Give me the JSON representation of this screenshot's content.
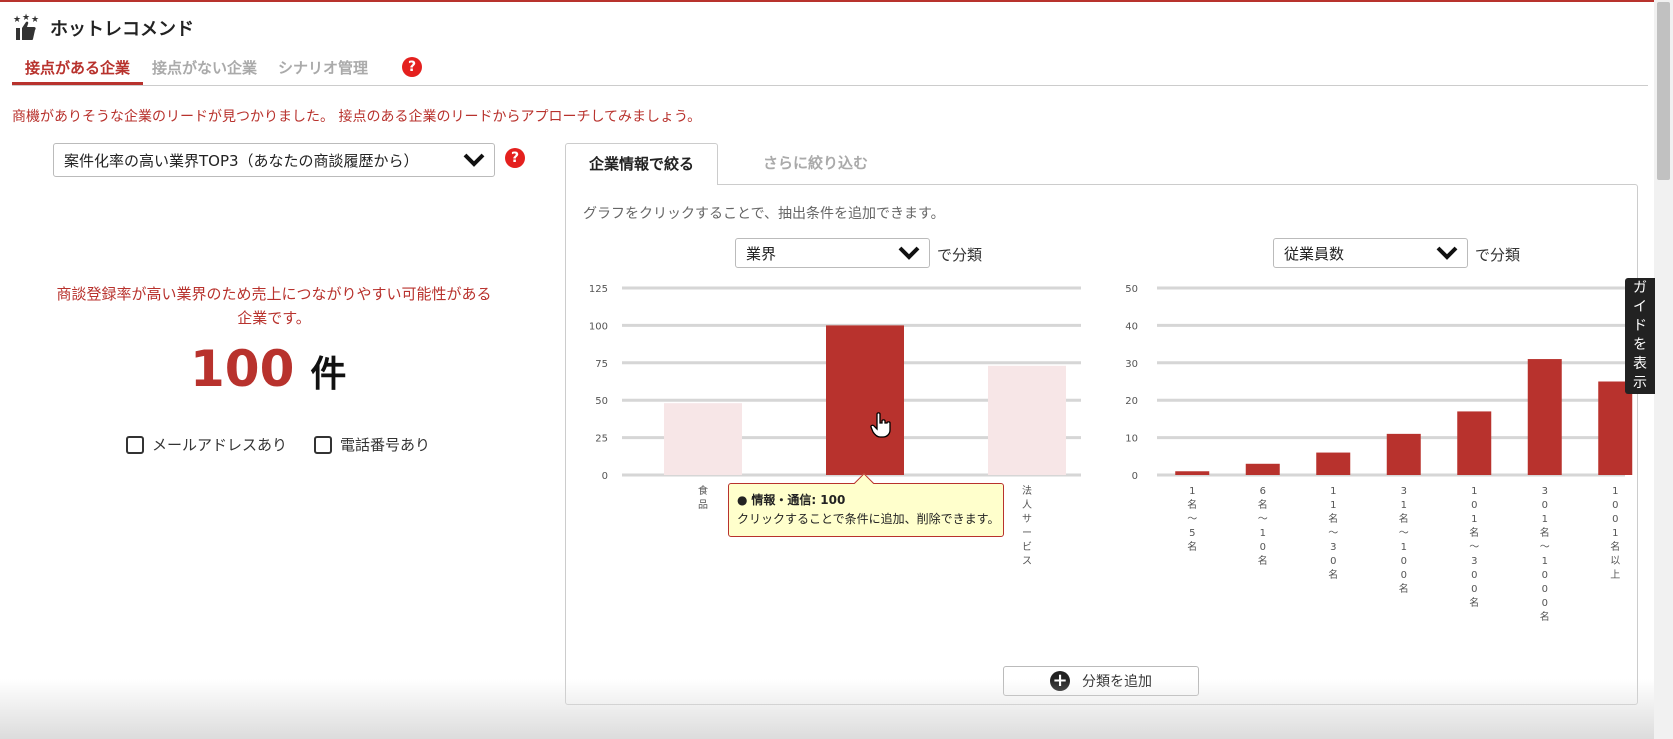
{
  "app": {
    "title": "ホットレコメンド"
  },
  "tabs": [
    {
      "label": "接点がある企業",
      "active": true
    },
    {
      "label": "接点がない企業",
      "active": false
    },
    {
      "label": "シナリオ管理",
      "active": false
    }
  ],
  "help_glyph": "?",
  "info_text": "商機がありそうな企業のリードが見つかりました。 接点のある企業のリードからアプローチしてみましょう。",
  "left": {
    "select_value": "案件化率の高い業界TOP3（あなたの商談履歴から）",
    "description": "商談登録率が高い業界のため売上につながりやすい可能性がある企業です。",
    "count": "100",
    "count_unit": "件",
    "checkboxes": [
      {
        "label": "メールアドレスあり",
        "checked": false
      },
      {
        "label": "電話番号あり",
        "checked": false
      }
    ]
  },
  "right": {
    "tabs": [
      {
        "label": "企業情報で絞る",
        "active": true
      },
      {
        "label": "さらに絞り込む",
        "active": false
      }
    ],
    "hint": "グラフをクリックすることで、抽出条件を追加できます。",
    "classify_suffix": "で分類",
    "select_industry": "業界",
    "select_employees": "従業員数",
    "add_button": "分類を追加",
    "tooltip": {
      "bullet": "●",
      "title": "情報・通信: 100",
      "body": "クリックすることで条件に追加、削除できます。"
    }
  },
  "guide_button": "ガイドを表示",
  "colors": {
    "accent": "#b8322d",
    "bar_active": "#b8322d",
    "bar_inactive": "#f7e6e7",
    "help": "#e4201e",
    "tooltip_bg": "#ffffcc"
  },
  "chart_data": [
    {
      "type": "bar",
      "categories": [
        "食品",
        "情報・通信",
        "法人サービス"
      ],
      "tick_labels": [
        "食品",
        "",
        "法人サービス"
      ],
      "values": [
        48,
        100,
        73
      ],
      "ylim": [
        0,
        125
      ],
      "yticks": [
        0,
        25,
        50,
        75,
        100,
        125
      ],
      "highlighted": [
        false,
        true,
        false
      ],
      "grid": true
    },
    {
      "type": "bar",
      "categories": [
        "1名〜5名",
        "6名〜10名",
        "11名〜30名",
        "31名〜100名",
        "101名〜300名",
        "301名〜1000名",
        "1001名以上"
      ],
      "values": [
        1,
        3,
        6,
        11,
        17,
        31,
        25
      ],
      "ylim": [
        0,
        50
      ],
      "yticks": [
        0,
        10,
        20,
        30,
        40,
        50
      ],
      "grid": true
    }
  ]
}
